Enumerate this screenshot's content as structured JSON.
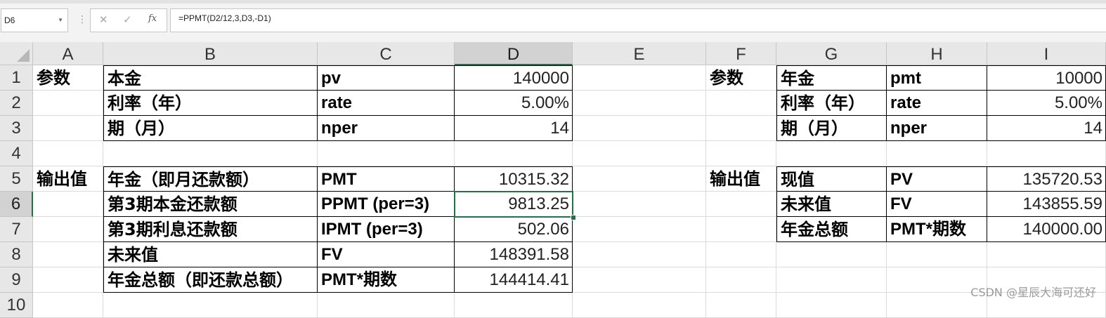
{
  "formula_bar": {
    "name_box": "D6",
    "formula": "=PPMT(D2/12,3,D3,-D1)",
    "cancel_icon": "✕",
    "enter_icon": "✓",
    "function_icon": "fx"
  },
  "columns": [
    "A",
    "B",
    "C",
    "D",
    "E",
    "F",
    "G",
    "H",
    "I"
  ],
  "rows": [
    "1",
    "2",
    "3",
    "4",
    "5",
    "6",
    "7",
    "8",
    "9",
    "10"
  ],
  "cells": {
    "A1": "参数",
    "B1": "本金",
    "C1": "pv",
    "D1": "140000",
    "B2": "利率（年）",
    "C2": "rate",
    "D2": "5.00%",
    "B3": "期（月）",
    "C3": "nper",
    "D3": "14",
    "A5": "输出值",
    "B5": "年金（即月还款额）",
    "C5": "PMT",
    "D5": "10315.32",
    "B6": "第3期本金还款额",
    "C6": "PPMT (per=3)",
    "D6": "9813.25",
    "B7": "第3期利息还款额",
    "C7": "IPMT (per=3)",
    "D7": "502.06",
    "B8": "未来值",
    "C8": "FV",
    "D8": "148391.58",
    "B9": "年金总额（即还款总额）",
    "C9": "PMT*期数",
    "D9": "144414.41",
    "F1": "参数",
    "G1": "年金",
    "H1": "pmt",
    "I1": "10000",
    "G2": "利率（年）",
    "H2": "rate",
    "I2": "5.00%",
    "G3": "期（月）",
    "H3": "nper",
    "I3": "14",
    "F5": "输出值",
    "G5": "现值",
    "H5": "PV",
    "I5": "135720.53",
    "G6": "未来值",
    "H6": "FV",
    "I6": "143855.59",
    "G7": "年金总额",
    "H7": "PMT*期数",
    "I7": "140000.00"
  },
  "selected_cell": "D6",
  "accent_color": "#217346",
  "watermark": "CSDN @星辰大海可还好"
}
